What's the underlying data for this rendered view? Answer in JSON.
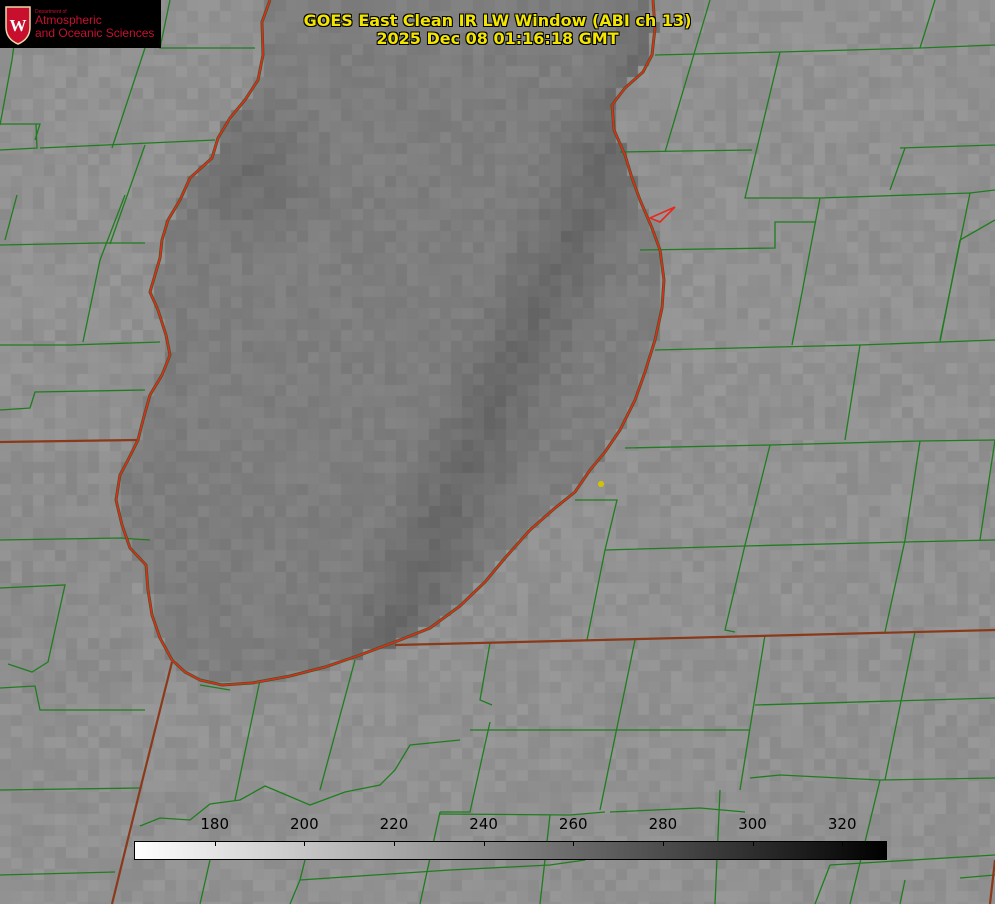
{
  "title": {
    "line1": "GOES East Clean IR LW Window (ABI ch 13)",
    "line2": "2025 Dec 08 01:16:18 GMT"
  },
  "logo": {
    "department": "Department of",
    "name_line1": "Atmospheric",
    "name_line2": "and Oceanic Sciences",
    "crest_letter": "W"
  },
  "colorbar": {
    "min": 162,
    "max": 330,
    "ticks": [
      180,
      200,
      220,
      240,
      260,
      280,
      300,
      320
    ],
    "labels": [
      "180",
      "200",
      "220",
      "240",
      "260",
      "280",
      "300",
      "320"
    ],
    "colormap": "grayscale-inverted"
  },
  "colors": {
    "land": "#8f8f8f",
    "lake": "#777777",
    "county_lines": "#1a7a1a",
    "coastline": "#e8281e",
    "state_lines": "#8a3a1a",
    "title": "#f2e600",
    "marker": "#d4c400"
  }
}
